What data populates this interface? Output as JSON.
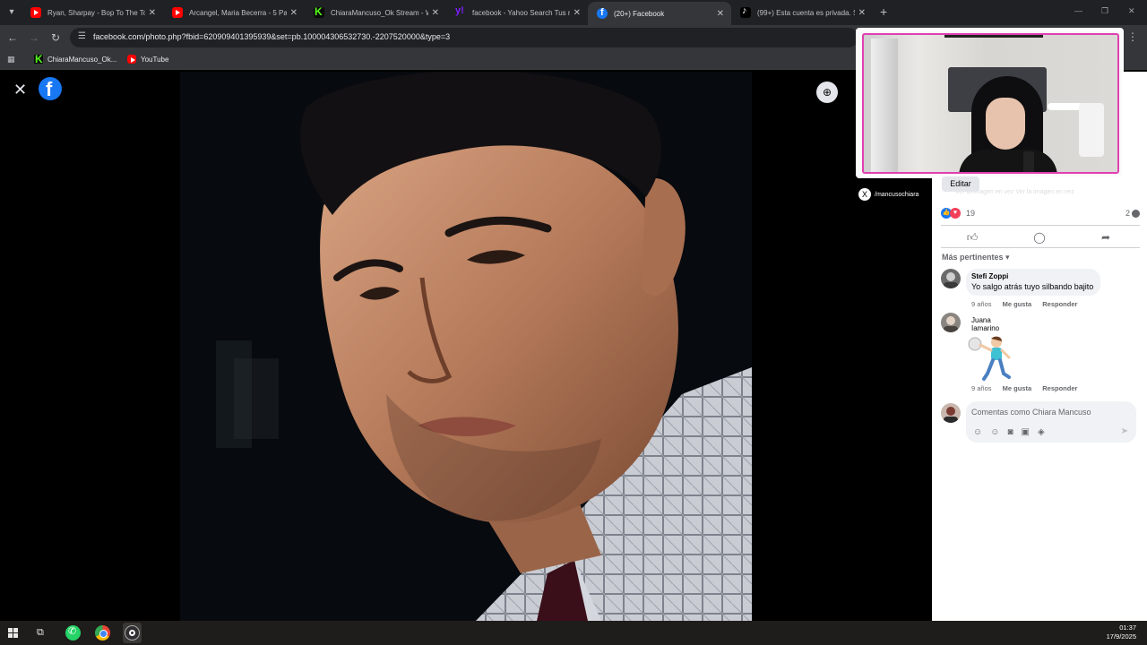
{
  "browser": {
    "tabs": [
      {
        "title": "Ryan, Sharpay - Bop To The Top",
        "favicon": "youtube-icon",
        "active": false
      },
      {
        "title": "Arcangel, Maria Becerra - 5 Pa L",
        "favicon": "youtube-icon",
        "active": false
      },
      {
        "title": "ChiaraMancuso_Ok Stream - W",
        "favicon": "kick-icon",
        "active": false
      },
      {
        "title": "facebook - Yahoo Search Tus re",
        "favicon": "yahoo-icon",
        "active": false
      },
      {
        "title": "(20+) Facebook",
        "favicon": "facebook-icon",
        "active": true
      },
      {
        "title": "(99+) Esta cuenta es privada. Si",
        "favicon": "tiktok-icon",
        "active": false
      }
    ],
    "url": "facebook.com/photo.php?fbid=620909401395939&set=pb.100004306532730.-2207520000&type=3",
    "bookmarks": [
      {
        "label": "ChiaraMancuso_Ok...",
        "favicon": "kick-icon"
      },
      {
        "label": "YouTube",
        "favicon": "youtube-icon"
      }
    ]
  },
  "viewer": {
    "close_icon": "close-icon",
    "logo": "facebook-logo",
    "zoom_icon": "zoom-in-icon"
  },
  "overlay": {
    "edit_label": "Editar",
    "tag_handle": "/mancusochiara",
    "faded_text": "Ver la imagen en vez    Ver la imagen en vez"
  },
  "post": {
    "reactions": {
      "count": "19",
      "types": [
        "like",
        "love"
      ]
    },
    "comments_count": "2",
    "sort_label": "Más pertinentes",
    "comments": [
      {
        "author": "Stefi Zoppi",
        "text": "Yo salgo atrás tuyo silbando bajito",
        "time": "9 años",
        "like": "Me gusta",
        "reply": "Responder"
      },
      {
        "author": "Juana Iamarino",
        "text": "",
        "sticker": "dancing-man-sticker",
        "time": "9 años",
        "like": "Me gusta",
        "reply": "Responder"
      }
    ],
    "composer_placeholder": "Comentas como Chiara Mancuso"
  },
  "taskbar": {
    "time": "01:37",
    "date": "17/9/2025"
  },
  "colors": {
    "facebook_blue": "#1877f2",
    "webcam_border": "#e040b0",
    "love": "#f33e58"
  }
}
